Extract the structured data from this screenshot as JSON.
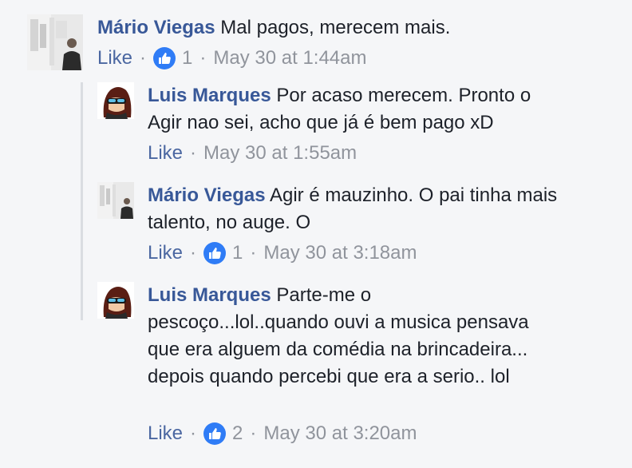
{
  "comments": [
    {
      "author": "Mário Viegas",
      "text": "Mal pagos, merecem mais.",
      "like_label": "Like",
      "reactions": "1",
      "timestamp": "May 30 at 1:44am",
      "avatar": "person-photo-avatar"
    },
    {
      "author": "Luis Marques",
      "text": "Por acaso merecem. Pronto o Agir nao sei, acho que já é bem pago xD",
      "like_label": "Like",
      "timestamp": "May 30 at 1:55am",
      "avatar": "cartoon-sunglasses-avatar"
    },
    {
      "author": "Mário Viegas",
      "text": "Agir é mauzinho. O pai tinha mais talento, no auge. O",
      "like_label": "Like",
      "reactions": "1",
      "timestamp": "May 30 at 3:18am",
      "avatar": "person-photo-avatar"
    },
    {
      "author": "Luis Marques",
      "text": "Parte-me o pescoço...lol..quando ouvi a musica pensava que era alguem da comédia na brincadeira... depois quando percebi que era a serio.. lol",
      "like_label": "Like",
      "reactions": "2",
      "timestamp": "May 30 at 3:20am",
      "avatar": "cartoon-sunglasses-avatar"
    }
  ],
  "colors": {
    "author": "#385898",
    "meta": "#90949c",
    "like_badge": "#2f7cf6",
    "background": "#f5f6f8"
  },
  "icons": [
    "thumbs-up-icon"
  ]
}
